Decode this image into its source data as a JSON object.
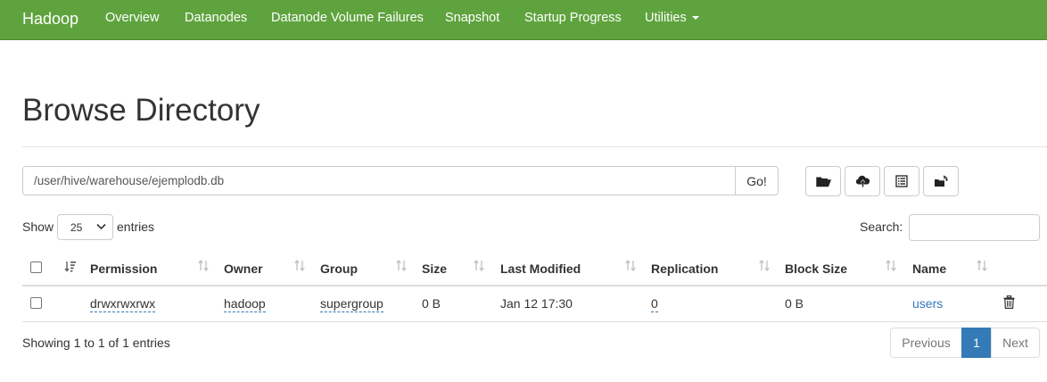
{
  "navbar": {
    "brand": "Hadoop",
    "items": [
      "Overview",
      "Datanodes",
      "Datanode Volume Failures",
      "Snapshot",
      "Startup Progress",
      "Utilities"
    ],
    "accent_color": "#5fa33e"
  },
  "page": {
    "title": "Browse Directory"
  },
  "pathbar": {
    "path_value": "/user/hive/warehouse/ejemplodb.db",
    "go_label": "Go!",
    "tool_icons": [
      "folder-open-icon",
      "cloud-upload-icon",
      "list-alt-icon",
      "cut-paste-icon"
    ]
  },
  "table_controls": {
    "show_label": "Show",
    "page_length": "25",
    "entries_label": "entries",
    "search_label": "Search:",
    "search_value": ""
  },
  "table": {
    "columns": [
      "Permission",
      "Owner",
      "Group",
      "Size",
      "Last Modified",
      "Replication",
      "Block Size",
      "Name"
    ],
    "rows": [
      {
        "permission": "drwxrwxrwx",
        "owner": "hadoop",
        "group": "supergroup",
        "size": "0 B",
        "last_modified": "Jan 12 17:30",
        "replication": "0",
        "block_size": "0 B",
        "name": "users"
      }
    ]
  },
  "footer": {
    "info": "Showing 1 to 1 of 1 entries",
    "prev_label": "Previous",
    "current_page": "1",
    "next_label": "Next",
    "pagination_active_color": "#337ab7"
  }
}
